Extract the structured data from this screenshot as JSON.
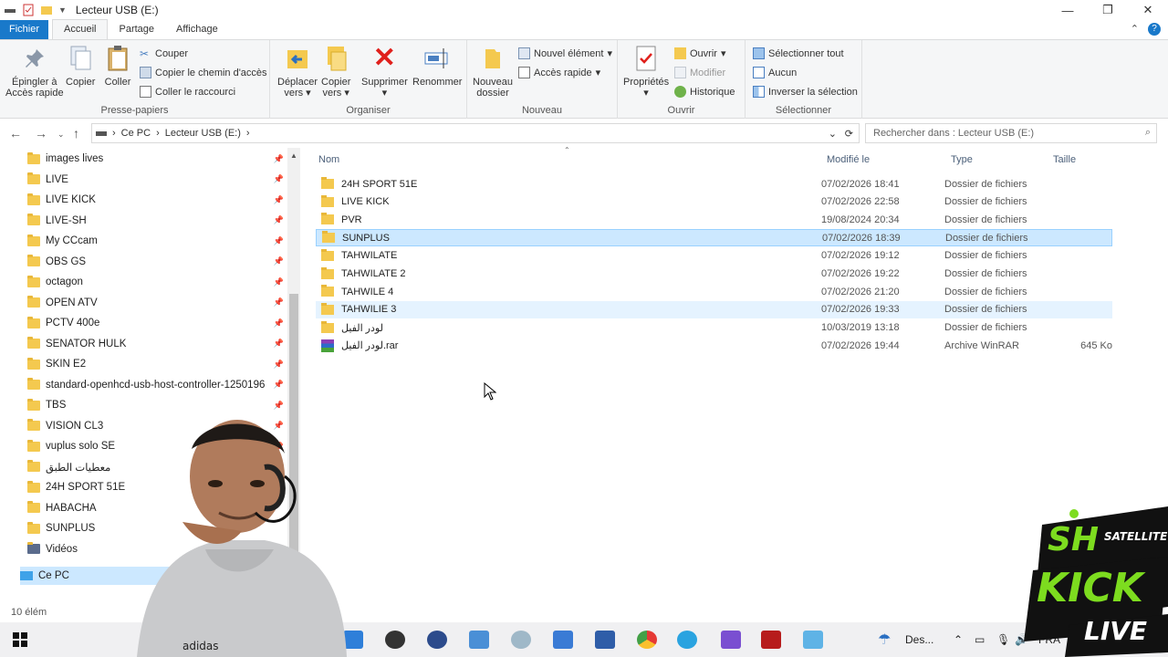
{
  "window": {
    "title": "Lecteur USB (E:)",
    "controls": [
      "—",
      "❐",
      "✕"
    ]
  },
  "ribbon_tabs": {
    "file": "Fichier",
    "home": "Accueil",
    "share": "Partage",
    "view": "Affichage"
  },
  "ribbon": {
    "clipboard": {
      "label": "Presse-papiers",
      "pin": "Épingler à\nAccès rapide",
      "pin_line1": "Épingler à",
      "pin_line2": "Accès rapide",
      "copy": "Copier",
      "paste": "Coller",
      "cut": "Couper",
      "copy_path": "Copier le chemin d'accès",
      "paste_shortcut": "Coller le raccourci"
    },
    "organize": {
      "label": "Organiser",
      "move_line1": "Déplacer",
      "move_line2": "vers",
      "copyto_line1": "Copier",
      "copyto_line2": "vers",
      "delete": "Supprimer",
      "rename": "Renommer"
    },
    "new": {
      "label": "Nouveau",
      "new_folder_line1": "Nouveau",
      "new_folder_line2": "dossier",
      "new_item": "Nouvel élément",
      "quick_access": "Accès rapide"
    },
    "open": {
      "label": "Ouvrir",
      "properties": "Propriétés",
      "open": "Ouvrir",
      "edit": "Modifier",
      "history": "Historique"
    },
    "select": {
      "label": "Sélectionner",
      "select_all": "Sélectionner tout",
      "select_none": "Aucun",
      "invert": "Inverser la sélection"
    }
  },
  "address": {
    "crumbs": [
      "Ce PC",
      "Lecteur USB (E:)"
    ],
    "search_placeholder": "Rechercher dans : Lecteur USB (E:)"
  },
  "nav_items": [
    "images lives",
    "LIVE",
    "LIVE KICK",
    "LIVE-SH",
    "My CCcam",
    "OBS GS",
    "octagon",
    "OPEN ATV",
    "PCTV 400e",
    "SENATOR HULK",
    "SKIN E2",
    "standard-openhcd-usb-host-controller-1250196",
    "TBS",
    "VISION CL3",
    "vuplus solo SE",
    "معطيات الطبق",
    "24H SPORT 51E",
    "HABACHA",
    "SUNPLUS",
    "Vidéos"
  ],
  "nav_this_pc": "Ce PC",
  "columns": {
    "name": "Nom",
    "modified": "Modifié le",
    "type": "Type",
    "size": "Taille"
  },
  "files": [
    {
      "name": "24H SPORT 51E",
      "modified": "07/02/2026 18:41",
      "type": "Dossier de fichiers",
      "size": ""
    },
    {
      "name": "LIVE KICK",
      "modified": "07/02/2026 22:58",
      "type": "Dossier de fichiers",
      "size": ""
    },
    {
      "name": "PVR",
      "modified": "19/08/2024 20:34",
      "type": "Dossier de fichiers",
      "size": ""
    },
    {
      "name": "SUNPLUS",
      "modified": "07/02/2026 18:39",
      "type": "Dossier de fichiers",
      "size": ""
    },
    {
      "name": "TAHWILATE",
      "modified": "07/02/2026 19:12",
      "type": "Dossier de fichiers",
      "size": ""
    },
    {
      "name": "TAHWILATE 2",
      "modified": "07/02/2026 19:22",
      "type": "Dossier de fichiers",
      "size": ""
    },
    {
      "name": "TAHWILE 4",
      "modified": "07/02/2026 21:20",
      "type": "Dossier de fichiers",
      "size": ""
    },
    {
      "name": "TAHWILIE 3",
      "modified": "07/02/2026 19:33",
      "type": "Dossier de fichiers",
      "size": ""
    },
    {
      "name": "لودر الفيل",
      "modified": "10/03/2019 13:18",
      "type": "Dossier de fichiers",
      "size": ""
    },
    {
      "name": "لودر الفيل.rar",
      "modified": "07/02/2026 19:44",
      "type": "Archive WinRAR",
      "size": "645 Ko"
    }
  ],
  "status": "10 élém",
  "taskbar": {
    "weather": "Des...",
    "lang": "FRA"
  },
  "logo": {
    "line1": "SH",
    "line2": "SATELLITE",
    "line3": "KICK",
    "line4": "LIVE"
  },
  "colors": {
    "accent": "#1979ca",
    "selected_row": "#cce8ff",
    "folder": "#f4c94f",
    "logo_green": "#7ddc1f"
  }
}
